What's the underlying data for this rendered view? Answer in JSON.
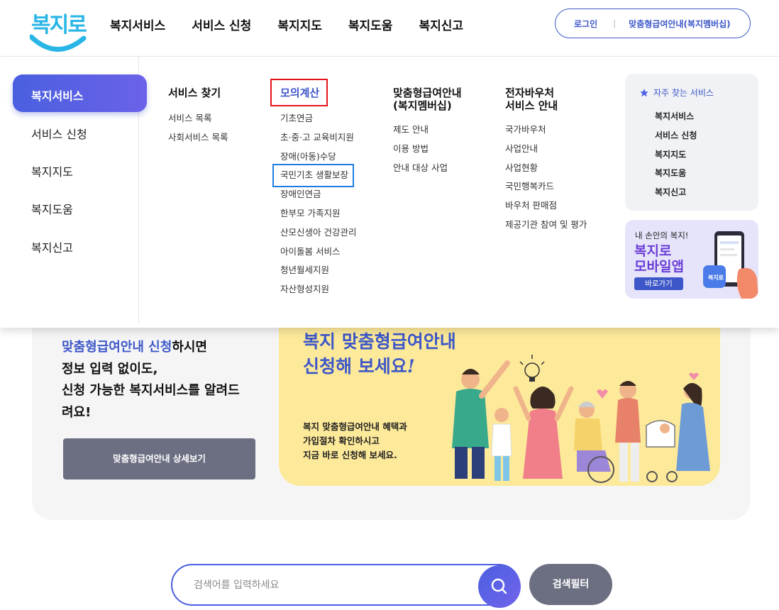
{
  "header": {
    "logo_text": "복지로",
    "nav": [
      "복지서비스",
      "서비스 신청",
      "복지지도",
      "복지도움",
      "복지신고"
    ],
    "util": {
      "login": "로그인",
      "member": "맞춤형급여안내(복지멤버십)"
    }
  },
  "mega": {
    "side_active": "복지서비스",
    "side_items": [
      "서비스 신청",
      "복지지도",
      "복지도움",
      "복지신고"
    ],
    "columns": [
      {
        "title": "서비스 찾기",
        "items": [
          "서비스 목록",
          "사회서비스 목록"
        ]
      },
      {
        "title": "모의계산",
        "items": [
          "기초연금",
          "초·중·고 교육비지원",
          "장애(아동)수당",
          "국민기초 생활보장",
          "장애인연금",
          "한부모 가족지원",
          "산모신생아 건강관리",
          "아이돌봄 서비스",
          "청년월세지원",
          "자산형성지원"
        ]
      },
      {
        "title_line1": "맞춤형급여안내",
        "title_line2": "(복지멤버십)",
        "items": [
          "제도 안내",
          "이용 방법",
          "안내 대상 사업"
        ]
      },
      {
        "title_line1": "전자바우처",
        "title_line2": "서비스 안내",
        "items": [
          "국가바우처",
          "사업안내",
          "사업현황",
          "국민행복카드",
          "바우처 판매점",
          "제공기관 참여 및 평가"
        ]
      }
    ],
    "favorites": {
      "title": "자주 찾는 서비스",
      "items": [
        "복지서비스",
        "서비스 신청",
        "복지지도",
        "복지도움",
        "복지신고"
      ]
    },
    "app_banner": {
      "sub": "내 손안의 복지!",
      "title1": "복지로",
      "title2": "모바일앱",
      "button": "바로가기",
      "app_icon_text": "복지로"
    }
  },
  "promo": {
    "hl1": "맞춤형급여안내 신청",
    "line1_rest": "하시면",
    "line2": "정보 입력 없이도,",
    "line3": "신청 가능한 복지서비스를 알려드",
    "line4": "려요!",
    "button": "맞춤형급여안내 상세보기"
  },
  "banner": {
    "headline1": "복지 맞춤형급여안내",
    "headline2": "신청해 보세요",
    "headline2_mark": "!",
    "desc1": "복지 맞춤형급여안내 혜택과",
    "desc2": "가입절차 확인하시고",
    "desc3": "지금 바로 신청해 보세요."
  },
  "search": {
    "placeholder": "검색어를 입력하세요",
    "value": "",
    "filter_label": "검색필터"
  },
  "colors": {
    "accent": "#3d57c8",
    "gradient_start": "#4a5fe0",
    "gradient_end": "#6b62e8",
    "highlight_red": "#e3131b",
    "highlight_blue": "#1e7de0",
    "banner_yellow": "#fde99a",
    "button_gray": "#6c6f82"
  },
  "icons": [
    "star-icon",
    "search-icon",
    "phone-illustration-icon",
    "family-illustration-icon",
    "lightbulb-icon"
  ]
}
